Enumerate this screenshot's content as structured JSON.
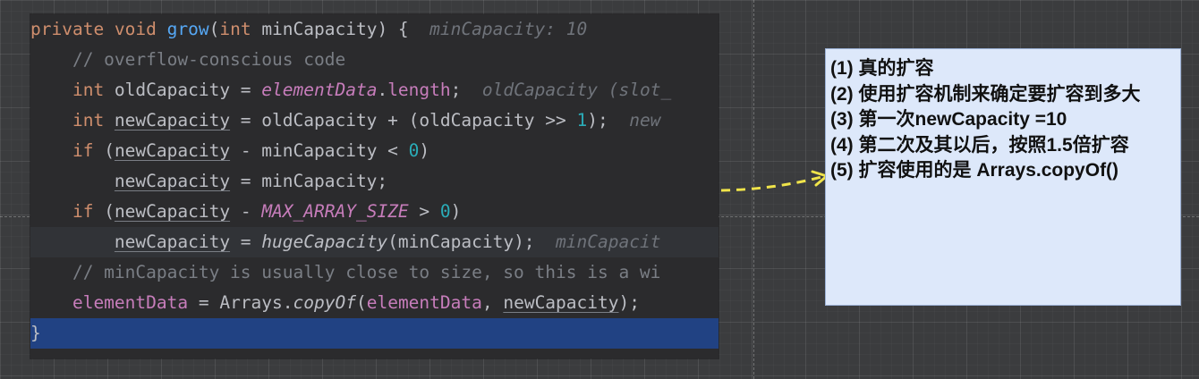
{
  "editor": {
    "lines": [
      {
        "style": "normal",
        "parts": [
          {
            "c": "kw",
            "t": "private "
          },
          {
            "c": "kw",
            "t": "void "
          },
          {
            "c": "fn",
            "t": "grow"
          },
          {
            "c": "pun",
            "t": "("
          },
          {
            "c": "kw",
            "t": "int "
          },
          {
            "c": "pun",
            "t": "minCapacity) {  "
          },
          {
            "c": "hint",
            "t": "minCapacity: 10"
          }
        ]
      },
      {
        "style": "normal",
        "parts": [
          {
            "c": "cmt",
            "t": "    // overflow-conscious code"
          }
        ]
      },
      {
        "style": "normal",
        "parts": [
          {
            "c": "kw",
            "t": "    int "
          },
          {
            "c": "pun",
            "t": "oldCapacity = "
          },
          {
            "c": "fit",
            "t": "elementData"
          },
          {
            "c": "pun",
            "t": "."
          },
          {
            "c": "fld",
            "t": "length"
          },
          {
            "c": "pun",
            "t": ";  "
          },
          {
            "c": "hint",
            "t": "oldCapacity (slot_"
          }
        ]
      },
      {
        "style": "normal",
        "parts": [
          {
            "c": "kw",
            "t": "    int "
          },
          {
            "c": "ul",
            "t": "newCapacity"
          },
          {
            "c": "pun",
            "t": " = oldCapacity + (oldCapacity >> "
          },
          {
            "c": "num",
            "t": "1"
          },
          {
            "c": "pun",
            "t": ");  "
          },
          {
            "c": "hint",
            "t": "new"
          }
        ]
      },
      {
        "style": "normal",
        "parts": [
          {
            "c": "kw",
            "t": "    if "
          },
          {
            "c": "pun",
            "t": "("
          },
          {
            "c": "ul",
            "t": "newCapacity"
          },
          {
            "c": "pun",
            "t": " - minCapacity < "
          },
          {
            "c": "num",
            "t": "0"
          },
          {
            "c": "pun",
            "t": ")"
          }
        ]
      },
      {
        "style": "normal",
        "parts": [
          {
            "c": "pun",
            "t": "        "
          },
          {
            "c": "ul",
            "t": "newCapacity"
          },
          {
            "c": "pun",
            "t": " = minCapacity;"
          }
        ]
      },
      {
        "style": "normal",
        "parts": [
          {
            "c": "kw",
            "t": "    if "
          },
          {
            "c": "pun",
            "t": "("
          },
          {
            "c": "ul",
            "t": "newCapacity"
          },
          {
            "c": "pun",
            "t": " - "
          },
          {
            "c": "fit",
            "t": "MAX_ARRAY_SIZE"
          },
          {
            "c": "pun",
            "t": " > "
          },
          {
            "c": "num",
            "t": "0"
          },
          {
            "c": "pun",
            "t": ")"
          }
        ]
      },
      {
        "style": "cur",
        "parts": [
          {
            "c": "pun",
            "t": "        "
          },
          {
            "c": "ul",
            "t": "newCapacity"
          },
          {
            "c": "pun",
            "t": " = "
          },
          {
            "c": "st",
            "t": "hugeCapacity"
          },
          {
            "c": "pun",
            "t": "(minCapacity);  "
          },
          {
            "c": "hint",
            "t": "minCapacit"
          }
        ]
      },
      {
        "style": "normal",
        "parts": [
          {
            "c": "cmt",
            "t": "    // minCapacity is usually close to size, so this is a wi"
          }
        ]
      },
      {
        "style": "normal",
        "parts": [
          {
            "c": "fld",
            "t": "    elementData"
          },
          {
            "c": "pun",
            "t": " = Arrays."
          },
          {
            "c": "st",
            "t": "copyOf"
          },
          {
            "c": "pun",
            "t": "("
          },
          {
            "c": "fld",
            "t": "elementData"
          },
          {
            "c": "pun",
            "t": ", "
          },
          {
            "c": "ul",
            "t": "newCapacity"
          },
          {
            "c": "pun",
            "t": ");"
          }
        ]
      },
      {
        "style": "sel",
        "parts": [
          {
            "c": "pun",
            "t": "}"
          }
        ]
      }
    ]
  },
  "note": {
    "lines": [
      "(1) 真的扩容",
      "(2) 使用扩容机制来确定要扩容到多大",
      "(3) 第一次newCapacity =10",
      "(4) 第二次及其以后，按照1.5倍扩容",
      "(5) 扩容使用的是 Arrays.copyOf()"
    ]
  },
  "colors": {
    "editor_bg": "#2b2b2d",
    "keyword": "#cf8e6d",
    "function": "#56a8f5",
    "field": "#c77dbb",
    "number": "#2aacb8",
    "comment": "#7a7e85",
    "selection": "#214283",
    "note_bg": "#dde8fa",
    "arrow": "#f0e44a"
  }
}
